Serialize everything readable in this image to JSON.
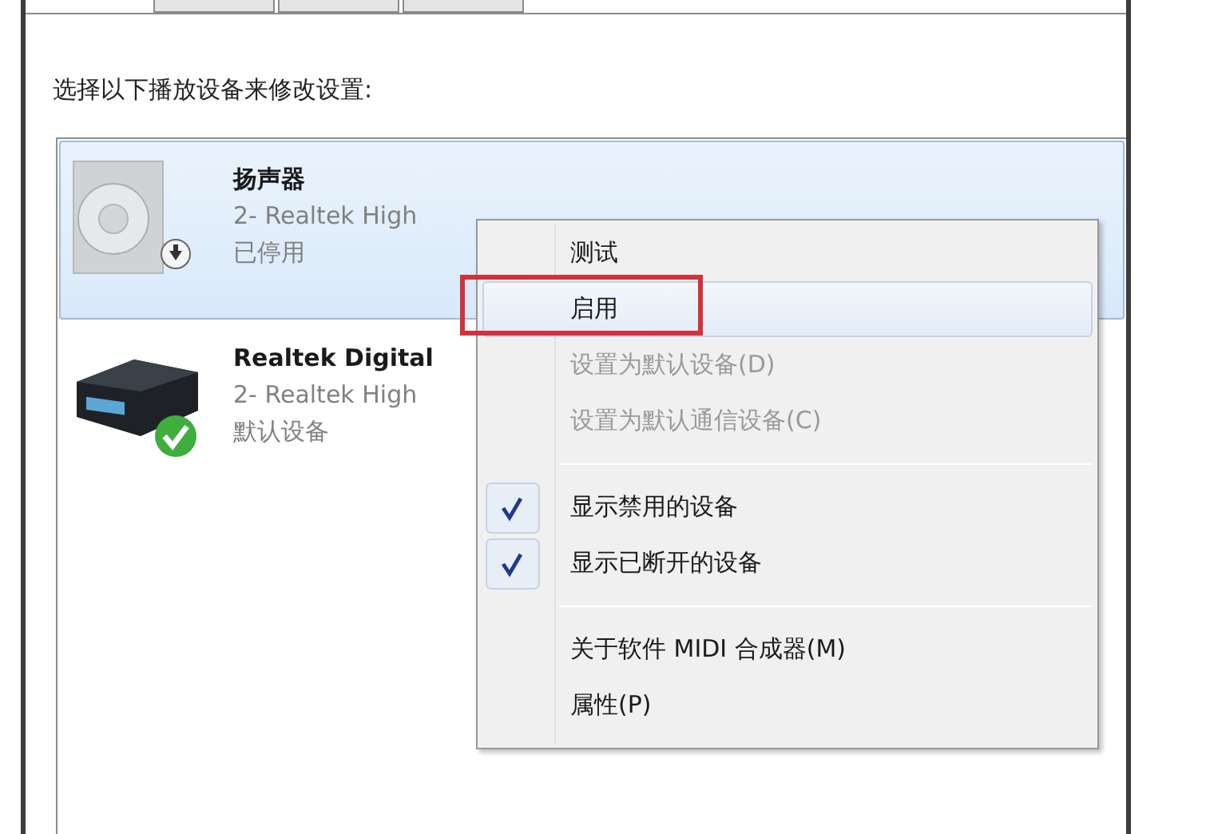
{
  "tabs": [
    {
      "selected": false
    },
    {
      "selected": false
    },
    {
      "selected": false
    }
  ],
  "instruction": "选择以下播放设备来修改设置:",
  "devices": [
    {
      "kind": "speaker",
      "name": "扬声器",
      "driver": "2- Realtek High",
      "status": "已停用",
      "is_default": false,
      "selected": true
    },
    {
      "kind": "receiver",
      "name": "Realtek Digital",
      "driver": "2- Realtek High",
      "status": "默认设备",
      "is_default": true,
      "selected": false
    }
  ],
  "context_menu": [
    {
      "kind": "item",
      "label": "测试",
      "disabled": false,
      "checked": false,
      "highlighted": false,
      "outlined": false
    },
    {
      "kind": "item",
      "label": "启用",
      "disabled": false,
      "checked": false,
      "highlighted": true,
      "outlined": true
    },
    {
      "kind": "item",
      "label": "设置为默认设备(D)",
      "disabled": true,
      "checked": false,
      "highlighted": false,
      "outlined": false
    },
    {
      "kind": "item",
      "label": "设置为默认通信设备(C)",
      "disabled": true,
      "checked": false,
      "highlighted": false,
      "outlined": false
    },
    {
      "kind": "separator"
    },
    {
      "kind": "item",
      "label": "显示禁用的设备",
      "disabled": false,
      "checked": true,
      "highlighted": false,
      "outlined": false
    },
    {
      "kind": "item",
      "label": "显示已断开的设备",
      "disabled": false,
      "checked": true,
      "highlighted": false,
      "outlined": false
    },
    {
      "kind": "separator"
    },
    {
      "kind": "item",
      "label": "关于软件 MIDI 合成器(M)",
      "disabled": false,
      "checked": false,
      "highlighted": false,
      "outlined": false
    },
    {
      "kind": "item",
      "label": "属性(P)",
      "disabled": false,
      "checked": false,
      "highlighted": false,
      "outlined": false
    }
  ]
}
